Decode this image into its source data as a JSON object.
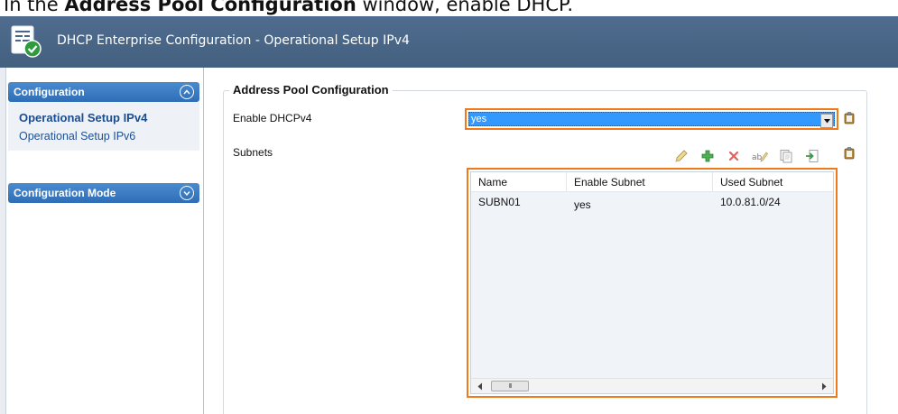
{
  "instruction": {
    "prefix": "In the ",
    "bold": "Address Pool Configuration",
    "suffix": " window, enable DHCP."
  },
  "window": {
    "title": "DHCP Enterprise Configuration - Operational Setup IPv4"
  },
  "sidebar": {
    "groups": [
      {
        "label": "Configuration",
        "expanded": true,
        "items": [
          {
            "label": "Operational Setup IPv4",
            "active": true
          },
          {
            "label": "Operational Setup IPv6",
            "active": false
          }
        ]
      },
      {
        "label": "Configuration Mode",
        "expanded": false,
        "items": []
      }
    ]
  },
  "main": {
    "group_title": "Address Pool Configuration",
    "enable_dhcpv4": {
      "label": "Enable DHCPv4",
      "value": "yes"
    },
    "subnets": {
      "label": "Subnets",
      "toolbar": [
        "edit-icon",
        "add-icon",
        "delete-icon",
        "rename-icon",
        "copy-icon",
        "import-icon"
      ],
      "columns": [
        "Name",
        "Enable Subnet",
        "Used Subnet"
      ],
      "rows": [
        [
          "SUBN01",
          "yes",
          "10.0.81.0/24"
        ]
      ],
      "scroll_thumb": "III"
    }
  },
  "colors": {
    "titlebar": "#4a6688",
    "nav_header": "#3a7cc4",
    "highlight_border": "#f07a1a",
    "selection": "#3399ff"
  }
}
